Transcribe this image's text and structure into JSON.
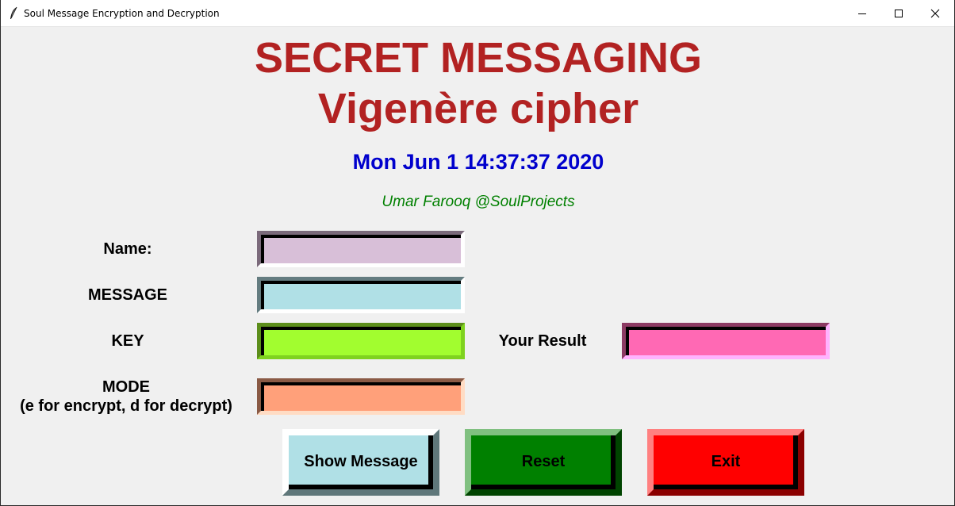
{
  "window": {
    "title": "Soul Message Encryption and Decryption",
    "icon": "feather-icon",
    "controls": [
      "minimize-icon",
      "maximize-icon",
      "close-icon"
    ]
  },
  "header": {
    "title_line1": "SECRET MESSAGING",
    "title_line2": "Vigenère cipher",
    "datetime": "Mon Jun  1 14:37:37 2020",
    "author": "Umar Farooq @SoulProjects"
  },
  "form": {
    "name_label": "Name:",
    "message_label": "MESSAGE",
    "key_label": "KEY",
    "mode_label_line1": "MODE",
    "mode_label_line2": "(e for encrypt, d for decrypt)",
    "result_label": "Your Result",
    "name_value": "",
    "message_value": "",
    "key_value": "",
    "mode_value": "",
    "result_value": ""
  },
  "buttons": {
    "show_message": "Show Message",
    "reset": "Reset",
    "exit": "Exit"
  },
  "colors": {
    "title": "#b22222",
    "datetime": "#0000cd",
    "author": "#008000",
    "name_field": "#d8bfd8",
    "message_field": "#b0e0e6",
    "key_field": "#a2fd2f",
    "mode_field": "#ffa07a",
    "result_field": "#ff69b4",
    "show_message_button": "#b0e0e6",
    "reset_button": "#008000",
    "exit_button": "#ff0000"
  }
}
